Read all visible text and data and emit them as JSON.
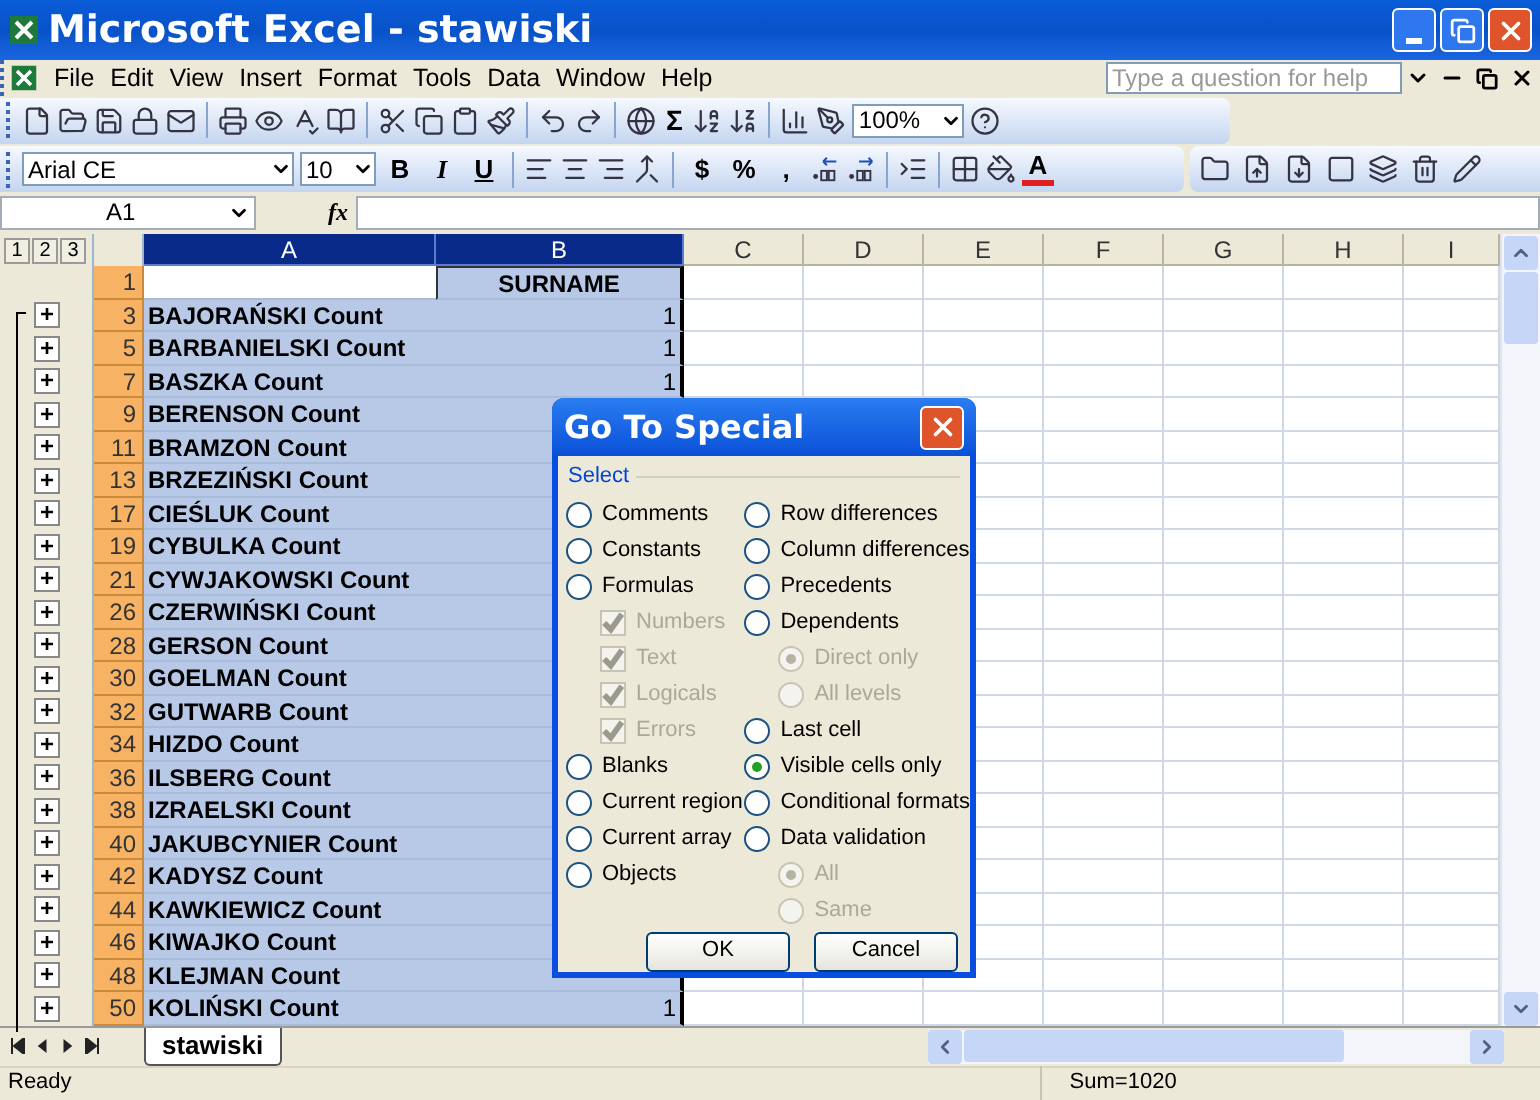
{
  "window": {
    "title": "Microsoft Excel - stawiski"
  },
  "menu": [
    "File",
    "Edit",
    "View",
    "Insert",
    "Format",
    "Tools",
    "Data",
    "Window",
    "Help"
  ],
  "help_box": {
    "placeholder": "Type a question for help"
  },
  "standard_toolbar": {
    "sum": "Σ",
    "zoom": "100%"
  },
  "formatting_toolbar": {
    "font": "Arial CE",
    "size": "10",
    "buttons": [
      "B",
      "I",
      "U"
    ],
    "number_buttons": [
      "$",
      "%",
      ","
    ],
    "font_color": "A"
  },
  "formula_bar": {
    "name_box": "A1",
    "fx": "fx"
  },
  "outline_levels": [
    "1",
    "2",
    "3"
  ],
  "columns": [
    {
      "label": "A",
      "selected": true
    },
    {
      "label": "B",
      "selected": true
    },
    {
      "label": "C",
      "selected": false
    },
    {
      "label": "D",
      "selected": false
    },
    {
      "label": "E",
      "selected": false
    },
    {
      "label": "F",
      "selected": false
    },
    {
      "label": "G",
      "selected": false
    },
    {
      "label": "H",
      "selected": false
    },
    {
      "label": "I",
      "selected": false
    }
  ],
  "rows": [
    {
      "num": "1",
      "b": "SURNAME"
    },
    {
      "num": "3",
      "a": "BAJORAŃSKI Count",
      "b": "1",
      "expand": "+"
    },
    {
      "num": "5",
      "a": "BARBANIELSKI Count",
      "b": "1",
      "expand": "+"
    },
    {
      "num": "7",
      "a": "BASZKA Count",
      "b": "1",
      "expand": "+"
    },
    {
      "num": "9",
      "a": "BERENSON Count",
      "expand": "+"
    },
    {
      "num": "11",
      "a": "BRAMZON Count",
      "expand": "+"
    },
    {
      "num": "13",
      "a": "BRZEZIŃSKI Count",
      "expand": "+"
    },
    {
      "num": "17",
      "a": "CIEŚLUK Count",
      "expand": "+"
    },
    {
      "num": "19",
      "a": "CYBULKA Count",
      "expand": "+"
    },
    {
      "num": "21",
      "a": "CYWJAKOWSKI Count",
      "expand": "+"
    },
    {
      "num": "26",
      "a": "CZERWIŃSKI Count",
      "expand": "+"
    },
    {
      "num": "28",
      "a": "GERSON Count",
      "expand": "+"
    },
    {
      "num": "30",
      "a": "GOELMAN Count",
      "expand": "+"
    },
    {
      "num": "32",
      "a": "GUTWARB Count",
      "expand": "+"
    },
    {
      "num": "34",
      "a": "HIZDO Count",
      "expand": "+"
    },
    {
      "num": "36",
      "a": "ILSBERG Count",
      "expand": "+"
    },
    {
      "num": "38",
      "a": "IZRAELSKI Count",
      "expand": "+"
    },
    {
      "num": "40",
      "a": "JAKUBCYNIER Count",
      "expand": "+"
    },
    {
      "num": "42",
      "a": "KADYSZ Count",
      "expand": "+"
    },
    {
      "num": "44",
      "a": "KAWKIEWICZ Count",
      "expand": "+"
    },
    {
      "num": "46",
      "a": "KIWAJKO Count",
      "expand": "+"
    },
    {
      "num": "48",
      "a": "KLEJMAN Count",
      "expand": "+"
    },
    {
      "num": "50",
      "a": "KOLIŃSKI Count",
      "b": "1",
      "expand": "+"
    }
  ],
  "sheet_tabs": [
    {
      "label": "stawiski",
      "selected": true
    }
  ],
  "status_bar": {
    "left": "Ready",
    "sum": "Sum=1020"
  },
  "dialog": {
    "title": "Go To Special",
    "group": "Select",
    "left": [
      {
        "kind": "radio",
        "label": "Comments",
        "selected": false,
        "disabled": false
      },
      {
        "kind": "radio",
        "label": "Constants",
        "selected": false,
        "disabled": false
      },
      {
        "kind": "radio",
        "label": "Formulas",
        "selected": false,
        "disabled": false,
        "children": [
          {
            "kind": "check",
            "label": "Numbers",
            "checked": true,
            "disabled": true
          },
          {
            "kind": "check",
            "label": "Text",
            "checked": true,
            "disabled": true
          },
          {
            "kind": "check",
            "label": "Logicals",
            "checked": true,
            "disabled": true
          },
          {
            "kind": "check",
            "label": "Errors",
            "checked": true,
            "disabled": true
          }
        ]
      },
      {
        "kind": "radio",
        "label": "Blanks",
        "selected": false,
        "disabled": false
      },
      {
        "kind": "radio",
        "label": "Current region",
        "selected": false,
        "disabled": false
      },
      {
        "kind": "radio",
        "label": "Current array",
        "selected": false,
        "disabled": false
      },
      {
        "kind": "radio",
        "label": "Objects",
        "selected": false,
        "disabled": false
      }
    ],
    "right": [
      {
        "kind": "radio",
        "label": "Row differences",
        "selected": false,
        "disabled": false
      },
      {
        "kind": "radio",
        "label": "Column differences",
        "selected": false,
        "disabled": false
      },
      {
        "kind": "radio",
        "label": "Precedents",
        "selected": false,
        "disabled": false
      },
      {
        "kind": "radio",
        "label": "Dependents",
        "selected": false,
        "disabled": false,
        "children": [
          {
            "kind": "radio",
            "label": "Direct only",
            "selected": true,
            "disabled": true
          },
          {
            "kind": "radio",
            "label": "All levels",
            "selected": false,
            "disabled": true
          }
        ]
      },
      {
        "kind": "radio",
        "label": "Last cell",
        "selected": false,
        "disabled": false
      },
      {
        "kind": "radio",
        "label": "Visible cells only",
        "selected": true,
        "disabled": false
      },
      {
        "kind": "radio",
        "label": "Conditional formats",
        "selected": false,
        "disabled": false
      },
      {
        "kind": "radio",
        "label": "Data validation",
        "selected": false,
        "disabled": false,
        "children": [
          {
            "kind": "radio",
            "label": "All",
            "selected": true,
            "disabled": true
          },
          {
            "kind": "radio",
            "label": "Same",
            "selected": false,
            "disabled": true
          }
        ]
      }
    ],
    "buttons": [
      "OK",
      "Cancel"
    ]
  }
}
